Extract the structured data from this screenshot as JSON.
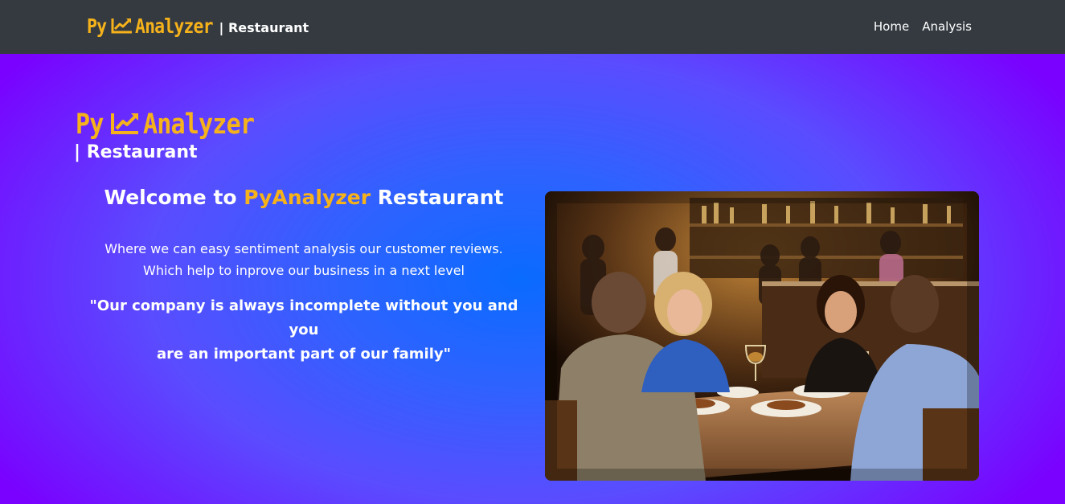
{
  "navbar": {
    "brand": {
      "logo_py": "Py",
      "logo_analyzer": "Analyzer",
      "subtitle": "| Restaurant"
    },
    "links": [
      {
        "label": "Home"
      },
      {
        "label": "Analysis"
      }
    ]
  },
  "hero": {
    "logo_py": "Py",
    "logo_analyzer": "Analyzer",
    "subtitle": "| Restaurant",
    "welcome_prefix": "Welcome to ",
    "welcome_brand": "PyAnalyzer",
    "welcome_suffix": " Restaurant",
    "description_line1": "Where we can easy sentiment analysis our customer reviews.",
    "description_line2": "Which help to inprove our business in a next level",
    "quote_line1": "\"Our company is always incomplete without you and you",
    "quote_line2": "are an important part of our family\""
  },
  "colors": {
    "navbar_bg": "#343a40",
    "brand_accent": "#f6b21b",
    "hero_center": "#0a6bff",
    "hero_edge": "#7a00ff",
    "text": "#ffffff"
  },
  "icons": {
    "logo_icon": "trending-up-chart-icon"
  }
}
